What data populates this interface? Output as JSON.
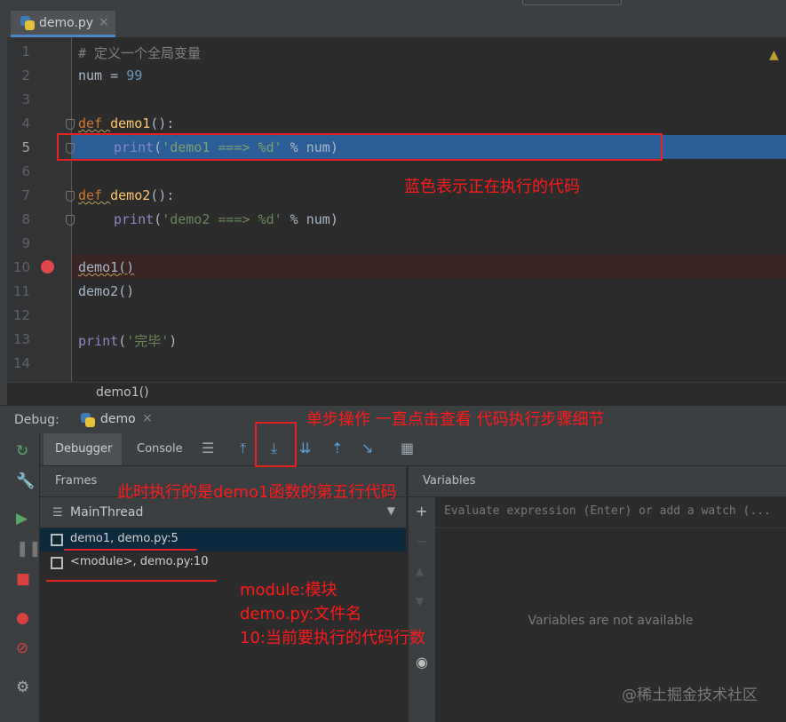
{
  "editor": {
    "tab": {
      "label": "demo.py",
      "close": "×"
    },
    "line_numbers": [
      "1",
      "2",
      "3",
      "4",
      "5",
      "6",
      "7",
      "8",
      "9",
      "10",
      "11",
      "12",
      "13",
      "14"
    ],
    "lines": {
      "l1": "# 定义一个全局变量",
      "l2_name": "num",
      "l2_eq": " = ",
      "l2_val": "99",
      "l4_kw": "def ",
      "l4_fn": "demo1",
      "l4_rest": "():",
      "l5_bi": "print",
      "l5_p": "(",
      "l5_str": "'demo1 ===> %d'",
      "l5_rest": " % num)",
      "l7_kw": "def ",
      "l7_fn": "demo2",
      "l7_rest": "():",
      "l8_bi": "print",
      "l8_p": "(",
      "l8_str": "'demo2 ===> %d'",
      "l8_rest": " % num)",
      "l10": "demo1()",
      "l11": "demo2()",
      "l13_bi": "print",
      "l13_p": "(",
      "l13_str": "'完毕'",
      "l13_rest": ")"
    },
    "breadcrumb": "demo1()",
    "warning_icon": "warning-icon"
  },
  "debug": {
    "label": "Debug:",
    "config_tab": "demo",
    "config_close": "×",
    "tabs": {
      "debugger": "Debugger",
      "console": "Console"
    },
    "frames_header": "Frames",
    "variables_header": "Variables",
    "thread": "MainThread",
    "frames": [
      "demo1, demo.py:5",
      "<module>, demo.py:10"
    ],
    "eval_placeholder": "Evaluate expression (Enter) or add a watch (...",
    "vars_empty": "Variables are not available"
  },
  "annotations": {
    "blue_note": "蓝色表示正在执行的代码",
    "step_note": "单步操作  一直点击查看  代码执行步骤细节",
    "frame_note": "此时执行的是demo1函数的第五行代码",
    "module_note": "module:模块",
    "file_note": "demo.py:文件名",
    "line_note": "10:当前要执行的代码行数"
  },
  "watermark": "@稀土掘金技术社区",
  "colors": {
    "execution_highlight": "#2d5d96",
    "breakpoint": "#e0474a",
    "annotation_red": "#ff1a1a"
  }
}
